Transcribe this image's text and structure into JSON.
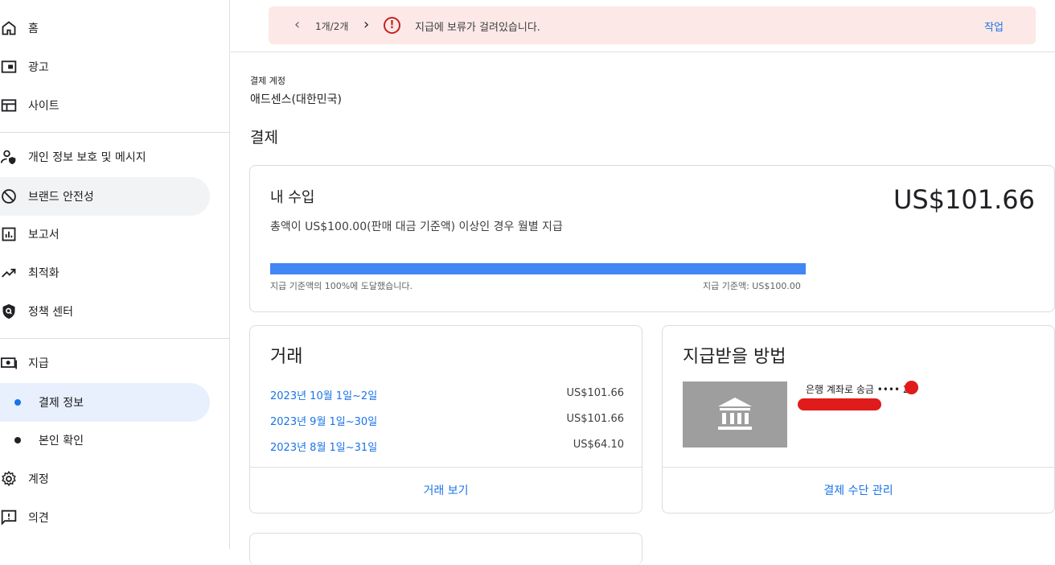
{
  "sidebar": {
    "items": [
      {
        "label": "홈",
        "icon": "home-icon"
      },
      {
        "label": "광고",
        "icon": "ads-icon"
      },
      {
        "label": "사이트",
        "icon": "sites-icon"
      },
      {
        "label": "개인 정보 보호 및 메시지",
        "icon": "privacy-icon"
      },
      {
        "label": "브랜드 안전성",
        "icon": "block-icon"
      },
      {
        "label": "보고서",
        "icon": "reports-icon"
      },
      {
        "label": "최적화",
        "icon": "trending-icon"
      },
      {
        "label": "정책 센터",
        "icon": "policy-shield-icon"
      },
      {
        "label": "지급",
        "icon": "payments-icon"
      },
      {
        "label": "결제 정보",
        "icon": "dot"
      },
      {
        "label": "본인 확인",
        "icon": "dot"
      },
      {
        "label": "계정",
        "icon": "gear-icon"
      },
      {
        "label": "의견",
        "icon": "feedback-icon"
      }
    ],
    "active": "결제 정보"
  },
  "alert": {
    "pager": "1개/2개",
    "message": "지급에 보류가 걸려있습니다.",
    "action": "작업",
    "accent": "#c5221f",
    "background": "#fce8e6"
  },
  "account": {
    "small_label": "결제 계정",
    "name": "애드센스(대한민국)"
  },
  "section_title": "결제",
  "earnings": {
    "title": "내 수입",
    "amount": "US$101.66",
    "description": "총액이 US$100.00(판매 대금 기준액) 이상인 경우 월별 지급",
    "progress_percent": 100,
    "progress_left": "지급 기준액의 100%에 도달했습니다.",
    "progress_right": "지급 기준액: US$100.00",
    "bar_color": "#4285f4"
  },
  "transactions": {
    "title": "거래",
    "rows": [
      {
        "period": "2023년 10월 1일~2일",
        "value": "US$101.66"
      },
      {
        "period": "2023년 9월 1일~30일",
        "value": "US$101.66"
      },
      {
        "period": "2023년 8월 1일~31일",
        "value": "US$64.10"
      }
    ],
    "footer": "거래 보기"
  },
  "payment_method": {
    "title": "지급받을 방법",
    "bank_label": "은행 계좌로 송금 •••• 20",
    "footer": "결제 수단 관리",
    "icon": "bank-icon"
  }
}
